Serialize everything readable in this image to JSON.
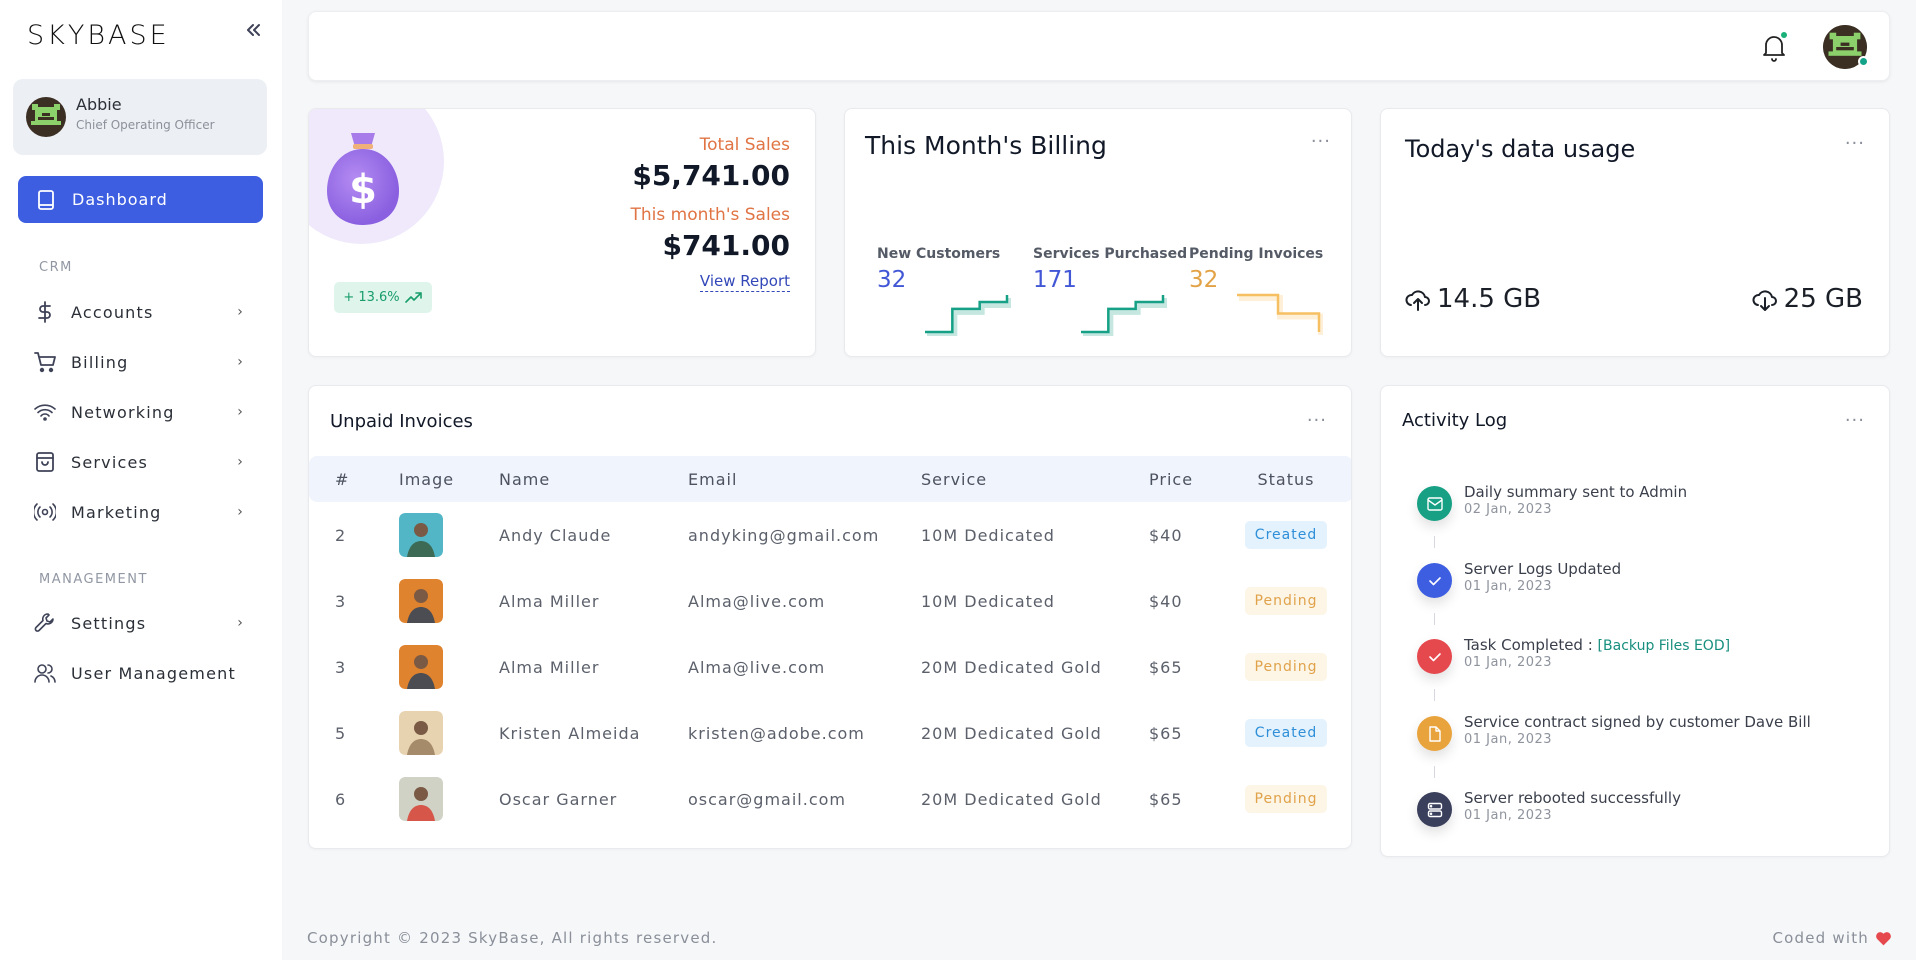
{
  "app": {
    "logo_text": "SKYBASE",
    "collapse_icon": "double-chevron-left-icon"
  },
  "user": {
    "name": "Abbie",
    "role": "Chief Operating Officer"
  },
  "sidebar": {
    "active": {
      "label": "Dashboard",
      "icon": "book-icon"
    },
    "sections": [
      {
        "title": "CRM",
        "items": [
          {
            "label": "Accounts",
            "icon": "dollar-icon",
            "has_children": true
          },
          {
            "label": "Billing",
            "icon": "cart-icon",
            "has_children": true
          },
          {
            "label": "Networking",
            "icon": "wifi-icon",
            "has_children": true
          },
          {
            "label": "Services",
            "icon": "shopping-bag-icon",
            "has_children": true
          },
          {
            "label": "Marketing",
            "icon": "broadcast-icon",
            "has_children": true
          }
        ]
      },
      {
        "title": "MANAGEMENT",
        "items": [
          {
            "label": "Settings",
            "icon": "wrench-icon",
            "has_children": true
          },
          {
            "label": "User Management",
            "icon": "users-icon",
            "has_children": false
          }
        ]
      }
    ]
  },
  "topbar": {
    "notification_icon": "bell-icon",
    "has_notifications": true,
    "user_online": true
  },
  "sales": {
    "total_label": "Total Sales",
    "total_value": "$5,741.00",
    "month_label": "This month's Sales",
    "month_value": "$741.00",
    "growth": "+ 13.6%",
    "view_report": "View Report",
    "colors": {
      "label": "#e07444",
      "growth": "#189d6b"
    }
  },
  "billing": {
    "title": "This Month's Billing",
    "stats": [
      {
        "label": "New Customers",
        "value": "32",
        "color": "#4257d6",
        "trend": [
          1,
          1,
          2,
          2,
          2.3,
          2.3,
          2.6
        ],
        "spark_color": "#16a085"
      },
      {
        "label": "Services Purchased",
        "value": "171",
        "color": "#4257d6",
        "trend": [
          1,
          1,
          2,
          2,
          2.3,
          2.3,
          2.6
        ],
        "spark_color": "#16a085"
      },
      {
        "label": "Pending Invoices",
        "value": "32",
        "color": "#e2a245",
        "trend": [
          3,
          3,
          3,
          2,
          2,
          2,
          1
        ],
        "spark_color": "#f6c062"
      }
    ]
  },
  "data_usage": {
    "title": "Today's data usage",
    "upload": "14.5 GB",
    "download": "25 GB"
  },
  "invoices": {
    "title": "Unpaid Invoices",
    "columns": [
      "#",
      "Image",
      "Name",
      "Email",
      "Service",
      "Price",
      "Status"
    ],
    "rows": [
      {
        "num": "2",
        "name": "Andy Claude",
        "email": "andyking@gmail.com",
        "service": "10M Dedicated",
        "price": "$40",
        "status": "Created",
        "avatar": [
          "#52b6c7",
          "#3c6a55"
        ]
      },
      {
        "num": "3",
        "name": "Alma Miller",
        "email": "Alma@live.com",
        "service": "10M Dedicated",
        "price": "$40",
        "status": "Pending",
        "avatar": [
          "#e0832e",
          "#4b4d52"
        ]
      },
      {
        "num": "3",
        "name": "Alma Miller",
        "email": "Alma@live.com",
        "service": "20M Dedicated Gold",
        "price": "$65",
        "status": "Pending",
        "avatar": [
          "#e0832e",
          "#4b4d52"
        ]
      },
      {
        "num": "5",
        "name": "Kristen Almeida",
        "email": "kristen@adobe.com",
        "service": "20M Dedicated Gold",
        "price": "$65",
        "status": "Created",
        "avatar": [
          "#e7d3b0",
          "#a68b6a"
        ]
      },
      {
        "num": "6",
        "name": "Oscar Garner",
        "email": "oscar@gmail.com",
        "service": "20M Dedicated Gold",
        "price": "$65",
        "status": "Pending",
        "avatar": [
          "#cfd2c5",
          "#d6564a"
        ]
      }
    ]
  },
  "activity": {
    "title": "Activity Log",
    "items": [
      {
        "text": "Daily summary sent to Admin",
        "link": "",
        "date": "02 Jan, 2023",
        "icon": "mail-icon",
        "color": "#17a084"
      },
      {
        "text": "Server Logs Updated",
        "link": "",
        "date": "01 Jan, 2023",
        "icon": "check-icon",
        "color": "#3d5ee1"
      },
      {
        "text": "Task Completed : ",
        "link": "[Backup Files EOD]",
        "date": "01 Jan, 2023",
        "icon": "check-icon",
        "color": "#e5484d"
      },
      {
        "text": "Service contract signed by customer Dave Bill",
        "link": "",
        "date": "01 Jan, 2023",
        "icon": "file-icon",
        "color": "#e9a33d"
      },
      {
        "text": "Server rebooted successfully",
        "link": "",
        "date": "01 Jan, 2023",
        "icon": "server-icon",
        "color": "#3a3f5c"
      }
    ]
  },
  "footer": {
    "copyright": "Copyright © 2023 SkyBase, All rights reserved.",
    "coded_with": "Coded with",
    "heart_color": "#e5484d"
  }
}
